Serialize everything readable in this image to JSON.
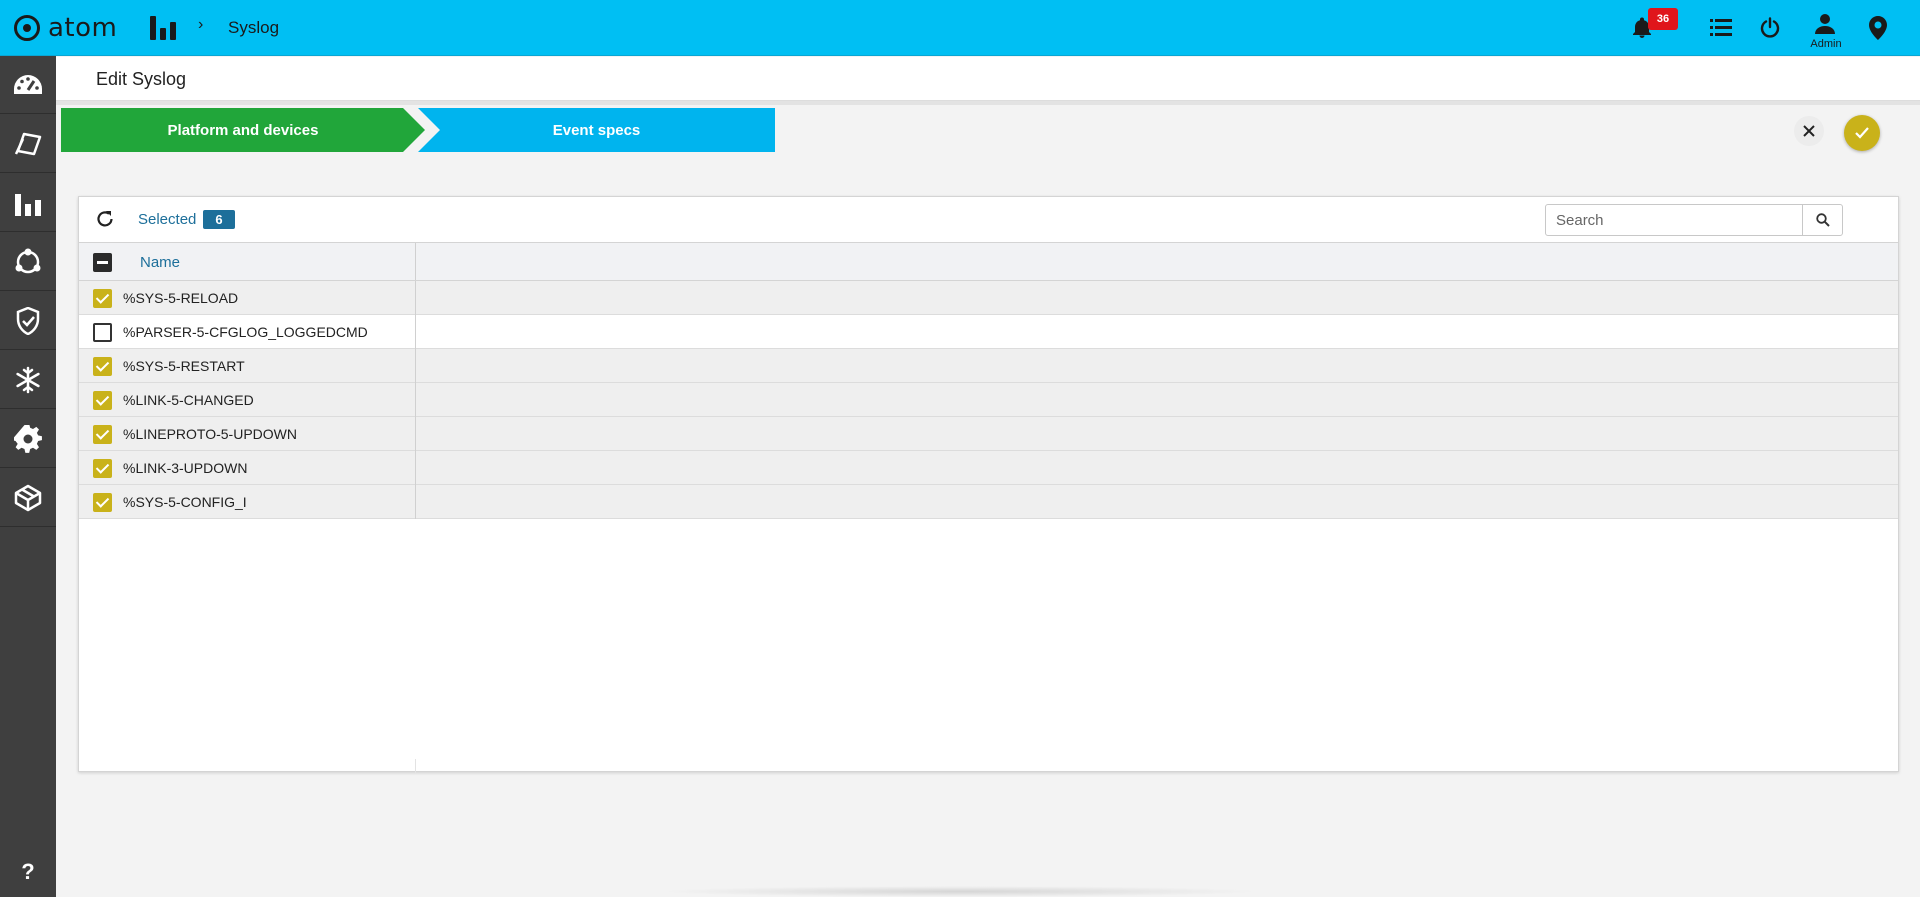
{
  "app": {
    "name": "atom"
  },
  "breadcrumb": {
    "current": "Syslog",
    "separator": "›"
  },
  "header": {
    "notification_count": "36",
    "user_label": "Admin"
  },
  "page": {
    "title": "Edit Syslog"
  },
  "wizard": {
    "steps": [
      {
        "label": "Platform and devices",
        "state": "completed",
        "color": "#21a63a"
      },
      {
        "label": "Event specs",
        "state": "active",
        "color": "#00b4ee"
      }
    ]
  },
  "toolbar": {
    "selected_label": "Selected",
    "selected_count": "6",
    "search_placeholder": "Search"
  },
  "table": {
    "columns": [
      "Name"
    ],
    "rows": [
      {
        "name": "%SYS-5-RELOAD",
        "checked": true
      },
      {
        "name": "%PARSER-5-CFGLOG_LOGGEDCMD",
        "checked": false
      },
      {
        "name": "%SYS-5-RESTART",
        "checked": true
      },
      {
        "name": "%LINK-5-CHANGED",
        "checked": true
      },
      {
        "name": "%LINEPROTO-5-UPDOWN",
        "checked": true
      },
      {
        "name": "%LINK-3-UPDOWN",
        "checked": true
      },
      {
        "name": "%SYS-5-CONFIG_I",
        "checked": true
      }
    ]
  },
  "sidebar": {
    "items": [
      {
        "icon": "dashboard-gauge-icon"
      },
      {
        "icon": "devices-icon"
      },
      {
        "icon": "analytics-bars-icon"
      },
      {
        "icon": "topology-icon"
      },
      {
        "icon": "security-shield-icon"
      },
      {
        "icon": "snowflake-icon"
      },
      {
        "icon": "settings-gear-icon"
      },
      {
        "icon": "cube-icon"
      }
    ],
    "help_label": "?"
  },
  "colors": {
    "topbar": "#00bff3",
    "sidebar": "#3f3f3f",
    "accent": "#c9b21a",
    "link": "#1d6f9a",
    "badge": "#e0151b"
  }
}
